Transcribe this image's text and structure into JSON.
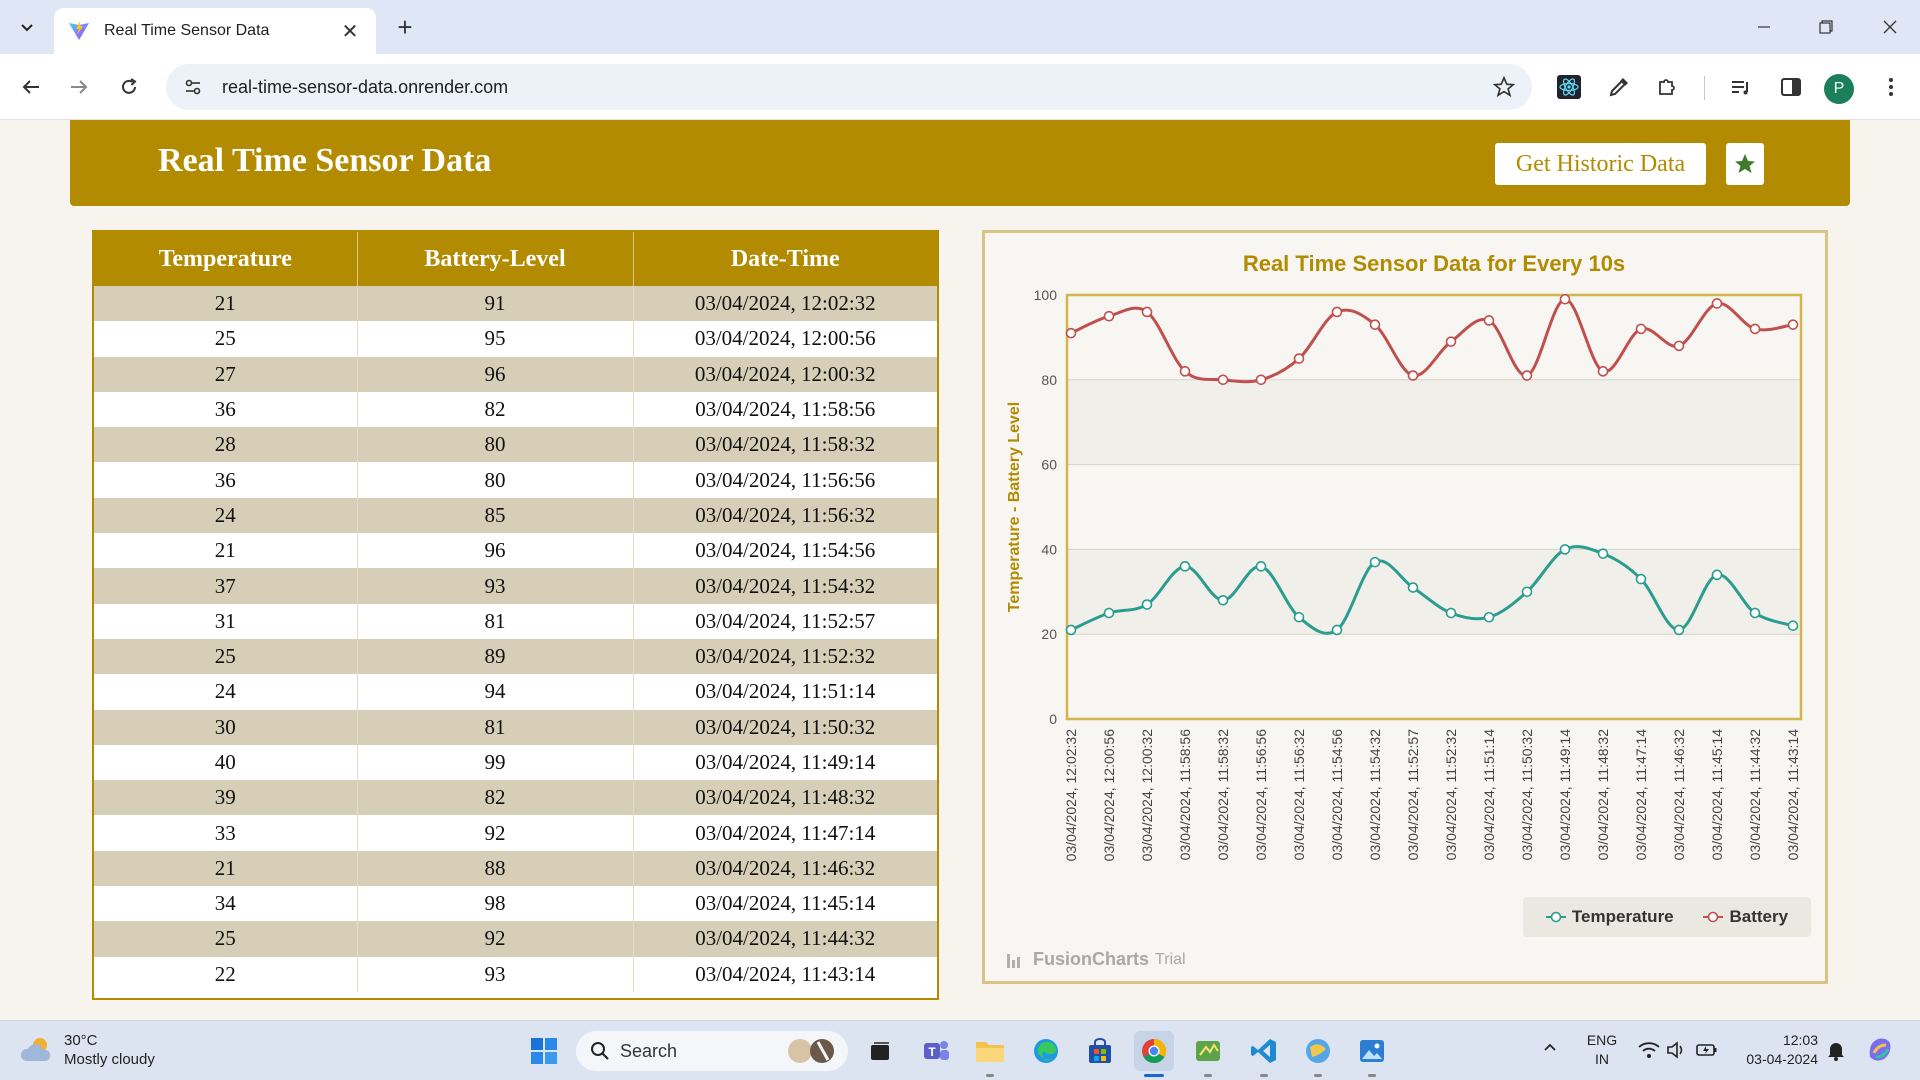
{
  "browser": {
    "tab_title": "Real Time Sensor Data",
    "url": "real-time-sensor-data.onrender.com",
    "profile_initial": "P"
  },
  "header": {
    "title": "Real Time Sensor Data",
    "historic_button": "Get Historic Data"
  },
  "table": {
    "columns": [
      "Temperature",
      "Battery-Level",
      "Date-Time"
    ],
    "rows": [
      [
        "21",
        "91",
        "03/04/2024, 12:02:32"
      ],
      [
        "25",
        "95",
        "03/04/2024, 12:00:56"
      ],
      [
        "27",
        "96",
        "03/04/2024, 12:00:32"
      ],
      [
        "36",
        "82",
        "03/04/2024, 11:58:56"
      ],
      [
        "28",
        "80",
        "03/04/2024, 11:58:32"
      ],
      [
        "36",
        "80",
        "03/04/2024, 11:56:56"
      ],
      [
        "24",
        "85",
        "03/04/2024, 11:56:32"
      ],
      [
        "21",
        "96",
        "03/04/2024, 11:54:56"
      ],
      [
        "37",
        "93",
        "03/04/2024, 11:54:32"
      ],
      [
        "31",
        "81",
        "03/04/2024, 11:52:57"
      ],
      [
        "25",
        "89",
        "03/04/2024, 11:52:32"
      ],
      [
        "24",
        "94",
        "03/04/2024, 11:51:14"
      ],
      [
        "30",
        "81",
        "03/04/2024, 11:50:32"
      ],
      [
        "40",
        "99",
        "03/04/2024, 11:49:14"
      ],
      [
        "39",
        "82",
        "03/04/2024, 11:48:32"
      ],
      [
        "33",
        "92",
        "03/04/2024, 11:47:14"
      ],
      [
        "21",
        "88",
        "03/04/2024, 11:46:32"
      ],
      [
        "34",
        "98",
        "03/04/2024, 11:45:14"
      ],
      [
        "25",
        "92",
        "03/04/2024, 11:44:32"
      ],
      [
        "22",
        "93",
        "03/04/2024, 11:43:14"
      ]
    ]
  },
  "chart_data": {
    "type": "line",
    "title": "Real Time Sensor Data for Every 10s",
    "ylabel": "Temperature - Battery Level",
    "xlabel": "",
    "ylim": [
      0,
      100
    ],
    "yticks": [
      0,
      20,
      40,
      60,
      80,
      100
    ],
    "categories": [
      "03/04/2024, 12:02:32",
      "03/04/2024, 12:00:56",
      "03/04/2024, 12:00:32",
      "03/04/2024, 11:58:56",
      "03/04/2024, 11:58:32",
      "03/04/2024, 11:56:56",
      "03/04/2024, 11:56:32",
      "03/04/2024, 11:54:56",
      "03/04/2024, 11:54:32",
      "03/04/2024, 11:52:57",
      "03/04/2024, 11:52:32",
      "03/04/2024, 11:51:14",
      "03/04/2024, 11:50:32",
      "03/04/2024, 11:49:14",
      "03/04/2024, 11:48:32",
      "03/04/2024, 11:47:14",
      "03/04/2024, 11:46:32",
      "03/04/2024, 11:45:14",
      "03/04/2024, 11:44:32",
      "03/04/2024, 11:43:14"
    ],
    "series": [
      {
        "name": "Temperature",
        "color": "#2a9d8f",
        "values": [
          21,
          25,
          27,
          36,
          28,
          36,
          24,
          21,
          37,
          31,
          25,
          24,
          30,
          40,
          39,
          33,
          21,
          34,
          25,
          22
        ]
      },
      {
        "name": "Battery",
        "color": "#c0504d",
        "values": [
          91,
          95,
          96,
          82,
          80,
          80,
          85,
          96,
          93,
          81,
          89,
          94,
          81,
          99,
          82,
          92,
          88,
          98,
          92,
          93
        ]
      }
    ],
    "legend_position": "bottom-right",
    "grid": true,
    "credit": "FusionCharts",
    "credit_suffix": "Trial"
  },
  "taskbar": {
    "temperature": "30°C",
    "weather": "Mostly cloudy",
    "search_label": "Search",
    "lang_line1": "ENG",
    "lang_line2": "IN",
    "time": "12:03",
    "date": "03-04-2024"
  },
  "colors": {
    "brand": "#b38b00",
    "temperature": "#2a9d8f",
    "battery": "#c0504d"
  }
}
